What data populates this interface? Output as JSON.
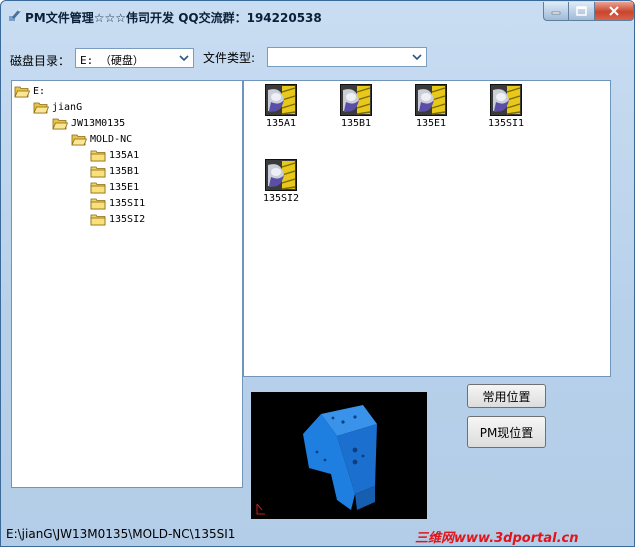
{
  "window": {
    "title": "PM文件管理☆☆☆伟司开发 QQ交流群：194220538"
  },
  "controls": {
    "disk_label": "磁盘目录：",
    "disk_value": "E: （硬盘）",
    "filetype_label": "文件类型:",
    "filetype_value": ""
  },
  "tree": [
    {
      "label": "E:",
      "icon": "folder-open-icon"
    },
    {
      "label": "jianG",
      "icon": "folder-open-icon"
    },
    {
      "label": "JW13M0135",
      "icon": "folder-open-icon"
    },
    {
      "label": "MOLD-NC",
      "icon": "folder-open-icon"
    },
    {
      "label": "135A1",
      "icon": "folder-icon"
    },
    {
      "label": "135B1",
      "icon": "folder-icon"
    },
    {
      "label": "135E1",
      "icon": "folder-icon"
    },
    {
      "label": "135SI1",
      "icon": "folder-icon"
    },
    {
      "label": "135SI2",
      "icon": "folder-icon"
    }
  ],
  "files": [
    {
      "label": "135A1",
      "icon": "pm-file-icon"
    },
    {
      "label": "135B1",
      "icon": "pm-file-icon"
    },
    {
      "label": "135E1",
      "icon": "pm-file-icon"
    },
    {
      "label": "135SI1",
      "icon": "pm-file-icon"
    },
    {
      "label": "135SI2",
      "icon": "pm-file-icon"
    }
  ],
  "buttons": {
    "common_location": "常用位置",
    "pm_current_location": "PM现位置"
  },
  "status": {
    "path": "E:\\jianG\\JW13M0135\\MOLD-NC\\135SI1"
  },
  "watermark": {
    "text": "三维网www.3dportal.cn"
  },
  "colors": {
    "model_blue": "#1e7fe0",
    "preview_bg": "#000000",
    "watermark_red": "#e2141a"
  }
}
